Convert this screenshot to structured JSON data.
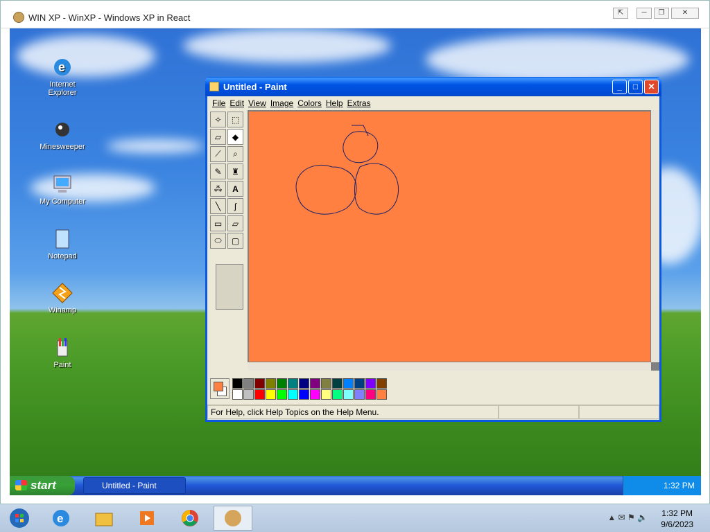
{
  "host": {
    "title": "WIN XP - WinXP - Windows XP in React",
    "controls": [
      "✕"
    ]
  },
  "desktop_icons": [
    {
      "label": "Internet Explorer",
      "icon": "ie-icon"
    },
    {
      "label": "Minesweeper",
      "icon": "minesweeper-icon"
    },
    {
      "label": "My Computer",
      "icon": "computer-icon"
    },
    {
      "label": "Notepad",
      "icon": "notepad-icon"
    },
    {
      "label": "Winamp",
      "icon": "winamp-icon"
    },
    {
      "label": "Paint",
      "icon": "paint-icon"
    }
  ],
  "paint": {
    "title": "Untitled - Paint",
    "menu": [
      "File",
      "Edit",
      "View",
      "Image",
      "Colors",
      "Help",
      "Extras"
    ],
    "tools": [
      "free-select",
      "rect-select",
      "eraser",
      "fill",
      "picker",
      "magnifier",
      "pencil",
      "brush",
      "airbrush",
      "text",
      "line",
      "curve",
      "rectangle",
      "polygon",
      "ellipse",
      "rounded-rect"
    ],
    "canvas_color": "#ff8040",
    "status_text": "For Help, click Help Topics on the Help Menu.",
    "palette_top": [
      "#000000",
      "#808080",
      "#800000",
      "#808000",
      "#008000",
      "#008080",
      "#000080",
      "#800080",
      "#808040",
      "#004040",
      "#0080ff",
      "#004080",
      "#8000ff",
      "#804000"
    ],
    "palette_bottom": [
      "#ffffff",
      "#c0c0c0",
      "#ff0000",
      "#ffff00",
      "#00ff00",
      "#00ffff",
      "#0000ff",
      "#ff00ff",
      "#ffff80",
      "#00ff80",
      "#80ffff",
      "#8080ff",
      "#ff0080",
      "#ff8040"
    ],
    "fg_color": "#ff8040",
    "bg_color": "#ffffff"
  },
  "xp_taskbar": {
    "start_label": "start",
    "task_label": "Untitled - Paint",
    "clock": "1:32 PM"
  },
  "w7_taskbar": {
    "time": "1:32 PM",
    "date": "9/6/2023"
  }
}
